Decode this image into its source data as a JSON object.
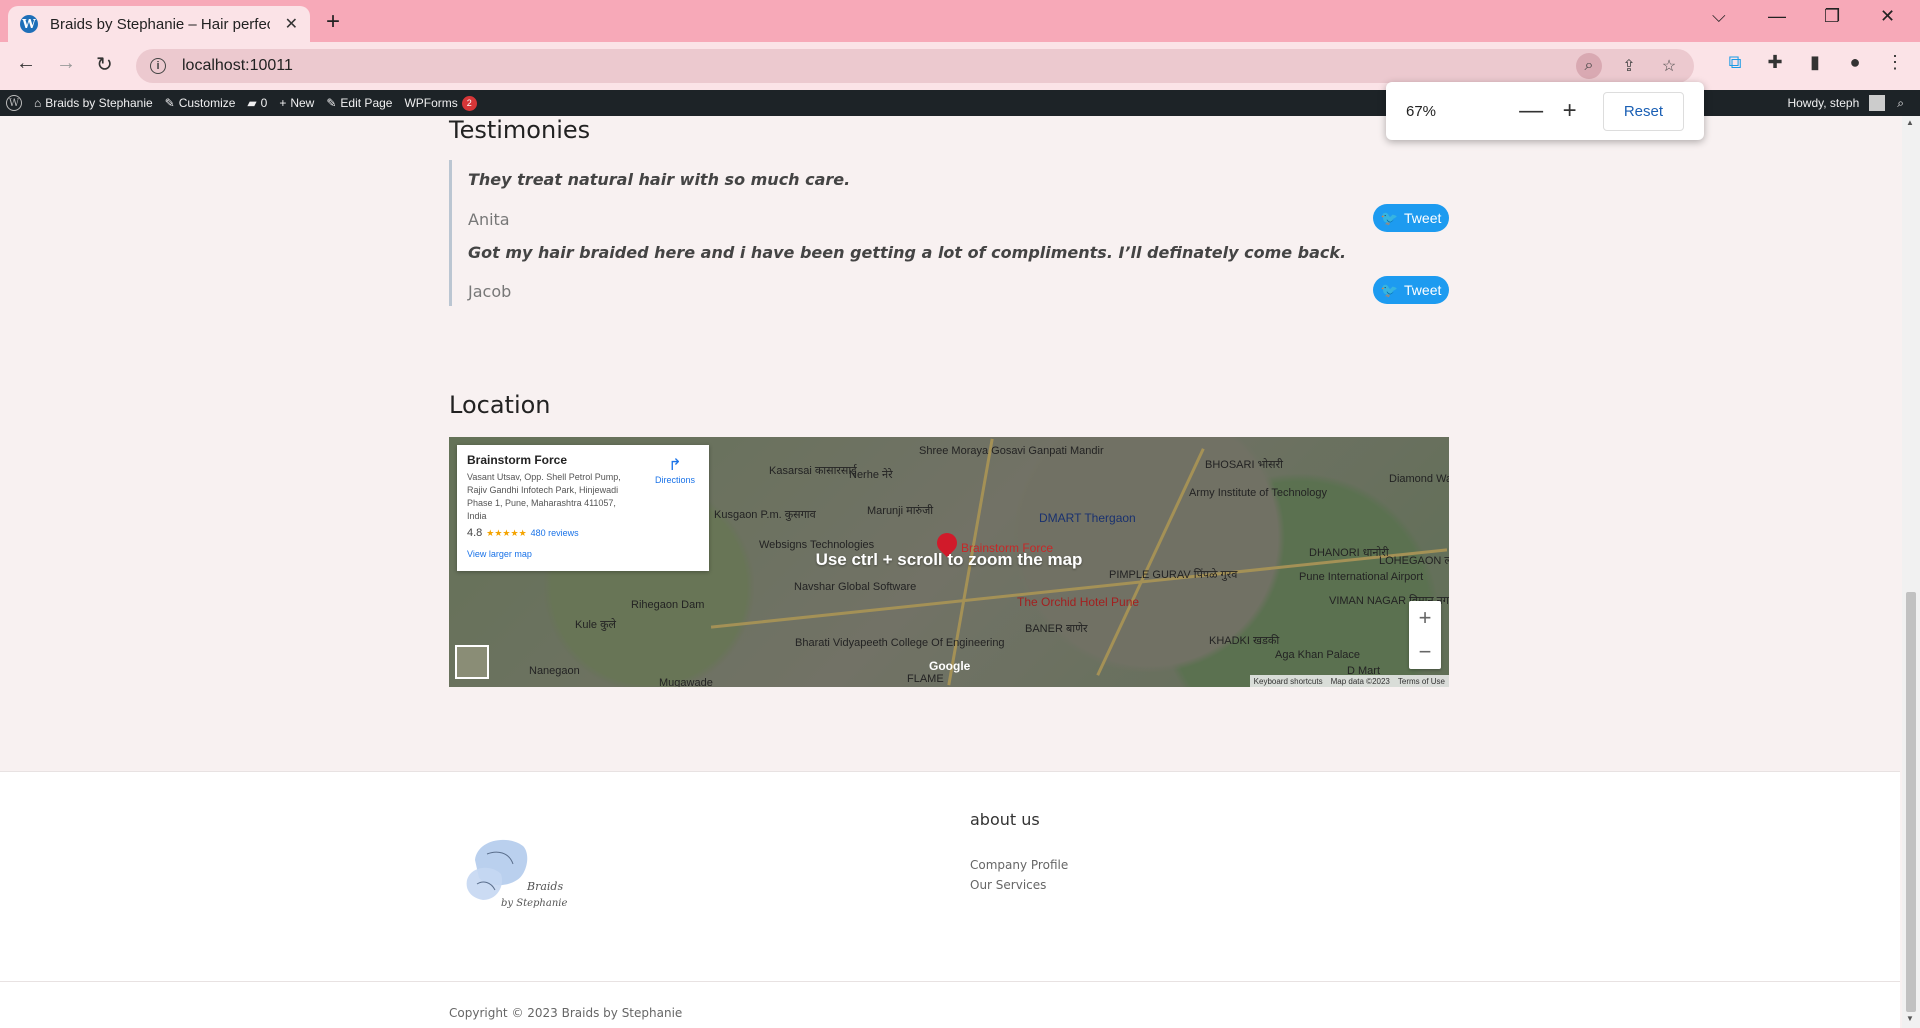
{
  "browser": {
    "tab_title": "Braids by Stephanie – Hair perfec",
    "new_tab": "+",
    "tab_close": "✕",
    "url": "localhost:10011",
    "window_controls": [
      "⌵",
      "—",
      "❐",
      "✕"
    ]
  },
  "adminbar": {
    "site_name": "Braids by Stephanie",
    "customize": "Customize",
    "comments_count": "0",
    "new": "New",
    "edit_page": "Edit Page",
    "wpforms": "WPForms",
    "wpforms_badge": "2",
    "howdy": "Howdy, steph"
  },
  "zoom_popup": {
    "level": "67%",
    "minus": "—",
    "plus": "+",
    "reset": "Reset"
  },
  "testimonies": {
    "heading": "Testimonies",
    "items": [
      {
        "quote": "They treat natural hair with so much care.",
        "author": "Anita",
        "tweet": "Tweet"
      },
      {
        "quote": "Got my hair braided here and i have been getting a lot of compliments. I’ll definately come back.",
        "author": "Jacob",
        "tweet": "Tweet"
      }
    ]
  },
  "location": {
    "heading": "Location",
    "map": {
      "overlay": "Use ctrl + scroll to zoom the map",
      "card_title": "Brainstorm Force",
      "card_address": "Vasant Utsav, Opp. Shell Petrol Pump, Rajiv Gandhi Infotech Park, Hinjewadi Phase 1, Pune, Maharashtra 411057, India",
      "rating": "4.8",
      "stars": "★★★★★",
      "reviews": "480 reviews",
      "directions": "Directions",
      "view_larger": "View larger map",
      "pin_label": "Brainstorm Force",
      "labels": [
        "Shree Moraya Gosavi Ganpati Mandir",
        "Kasarsai कासारसाई",
        "Nerhe नेरे",
        "Kusgaon P.m. कुसगाव",
        "Marunji मारुंजी",
        "DMART Thergaon",
        "Army Institute of Technology",
        "Diamond Wa",
        "Websigns Technologies",
        "Navshar Global Software",
        "The Orchid Hotel Pune",
        "Pune International Airport",
        "Rihegaon Dam",
        "Kule कुले",
        "Nanegaon",
        "Bharati Vidyapeeth College Of Engineering",
        "VIMAN NAGAR विमान नगर",
        "Aga Khan Palace",
        "BANER बाणेर",
        "PIMPLE GURAV पिंपळे गुरव",
        "KHADKI खडकी",
        "DHANORI धानोरी",
        "LOHEGAON लोहगाव",
        "BHOSARI भोसरी",
        "FLAME",
        "Mugawade",
        "D Mart"
      ],
      "zoom_in": "+",
      "zoom_out": "−",
      "google": "Google",
      "footer_items": [
        "Keyboard shortcuts",
        "Map data ©2023",
        "Terms of Use"
      ]
    }
  },
  "footer": {
    "about_title": "about us",
    "links": [
      "Company Profile",
      "Our Services"
    ],
    "copyright": "Copyright © 2023 Braids by Stephanie",
    "logo_text_1": "Braids",
    "logo_text_2": "by Stephanie"
  },
  "colors": {
    "tab_bar": "#f7a9b8",
    "admin_bar": "#1d2327",
    "tweet": "#1d9bf0",
    "link_blue": "#1a73e8"
  }
}
